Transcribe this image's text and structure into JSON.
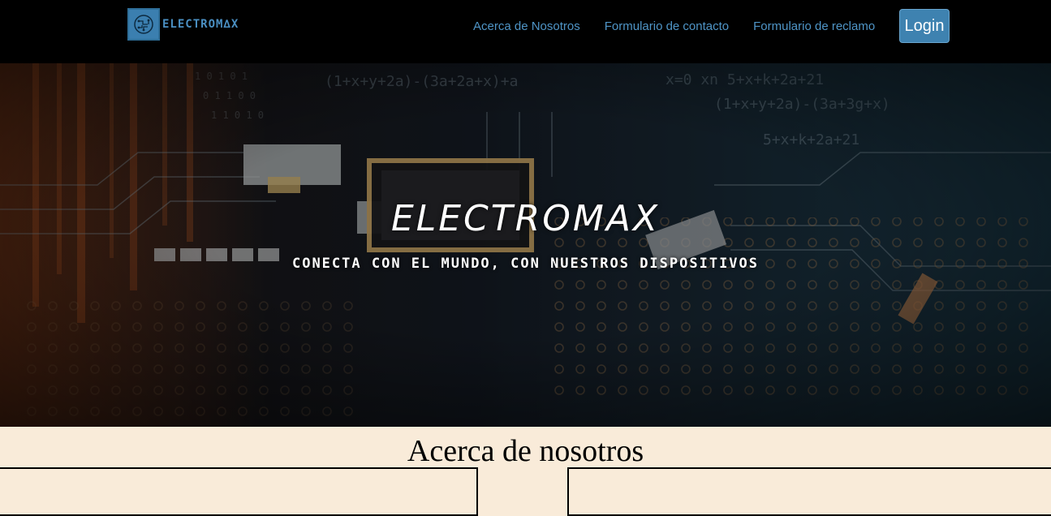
{
  "navbar": {
    "brand": "ELECTROM∆X",
    "links": [
      "Acerca de Nosotros",
      "Formulario de contacto",
      "Formulario de reclamo"
    ],
    "login_label": "Login"
  },
  "hero": {
    "title": "ELECTROMAX",
    "subtitle": "CONECTA CON EL MUNDO, CON NUESTROS DISPOSITIVOS"
  },
  "about": {
    "title": "Acerca de nosotros"
  },
  "colors": {
    "navbar_bg": "#000000",
    "link": "#4f95c7",
    "login_bg": "#3e82b0",
    "page_bg": "#f9ebd9"
  }
}
